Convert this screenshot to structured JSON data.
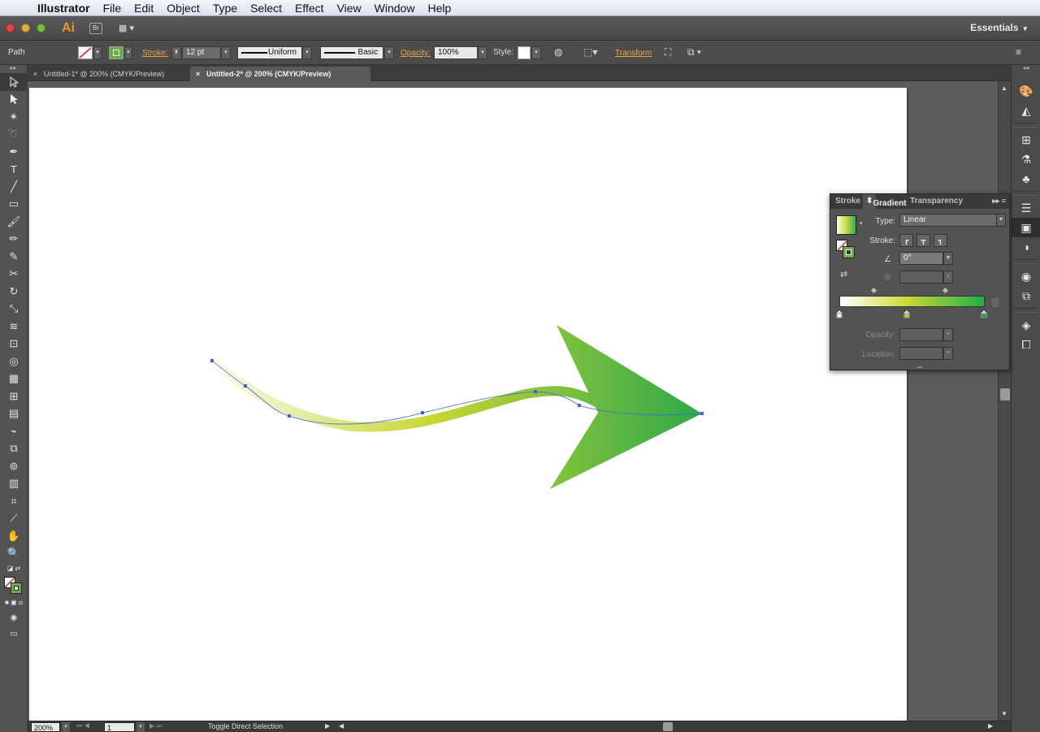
{
  "menubar": {
    "app_name": "Illustrator",
    "items": [
      "File",
      "Edit",
      "Object",
      "Type",
      "Select",
      "Effect",
      "View",
      "Window",
      "Help"
    ]
  },
  "appbar": {
    "logo": "Ai",
    "bridge_label": "Br",
    "workspace": "Essentials"
  },
  "control": {
    "selection_label": "Path",
    "stroke_label": "Stroke:",
    "stroke_weight": "12 pt",
    "profile": "Uniform",
    "brush": "Basic",
    "opacity_label": "Opacity:",
    "opacity_value": "100%",
    "style_label": "Style:",
    "transform_label": "Transform"
  },
  "tabs": [
    {
      "label": "Untitled-1* @ 200% (CMYK/Preview)",
      "close": "×"
    },
    {
      "label": "Untitled-2* @ 200% (CMYK/Preview)",
      "close": "×"
    }
  ],
  "status": {
    "zoom": "200%",
    "page": "1",
    "hint": "Toggle Direct Selection"
  },
  "gradient_panel": {
    "tabs": [
      "Stroke",
      "Gradient",
      "Transparency"
    ],
    "type_label": "Type:",
    "type_value": "Linear",
    "stroke_label": "Stroke:",
    "angle_value": "0°",
    "aspect_value": "",
    "opacity_label": "Opacity:",
    "location_label": "Location:",
    "stops": [
      {
        "color": "#ffffff",
        "location": 0
      },
      {
        "color": "#cbd832",
        "location": 47
      },
      {
        "color": "#1faf49",
        "location": 100
      }
    ]
  },
  "colors": {
    "accent_orange": "#e8982b",
    "gradient_start": "#f3f6d2",
    "gradient_mid": "#c7d632",
    "gradient_end": "#2ca84a",
    "path_selection": "#3d63e6"
  }
}
